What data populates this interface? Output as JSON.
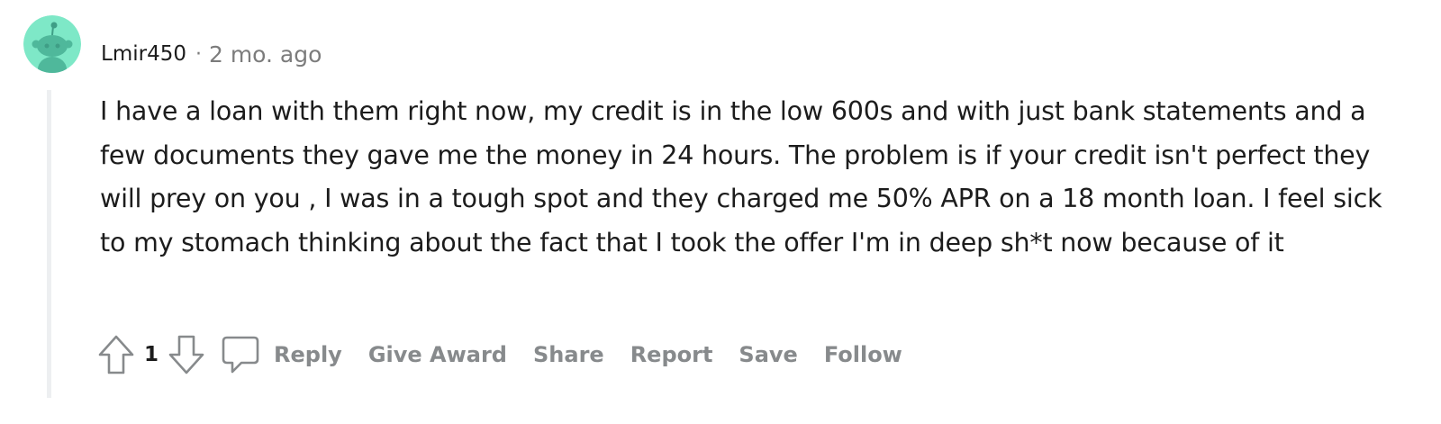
{
  "comment": {
    "author": "Lmir450",
    "separator": "·",
    "timestamp": "2 mo. ago",
    "body": "I have a loan with them right now, my credit is in the low 600s and with just bank statements and a few documents they gave me the money in 24 hours. The problem is if your credit isn't perfect they will prey on you , I was in a tough spot and they charged me 50% APR on a 18 month loan. I feel sick to my stomach thinking about the fact that I took the offer I'm in deep sh*t now because of it",
    "avatar_icon": "snoo-avatar-icon",
    "avatar_color": "#7ee8c7"
  },
  "actions": {
    "upvote_icon": "upvote-arrow-icon",
    "score": "1",
    "downvote_icon": "downvote-arrow-icon",
    "reply_icon": "speech-bubble-icon",
    "reply": "Reply",
    "give_award": "Give Award",
    "share": "Share",
    "report": "Report",
    "save": "Save",
    "follow": "Follow"
  },
  "colors": {
    "text": "#1c1c1c",
    "meta": "#7c7c7c",
    "action": "#878a8c",
    "thread_line": "#edeff1"
  }
}
